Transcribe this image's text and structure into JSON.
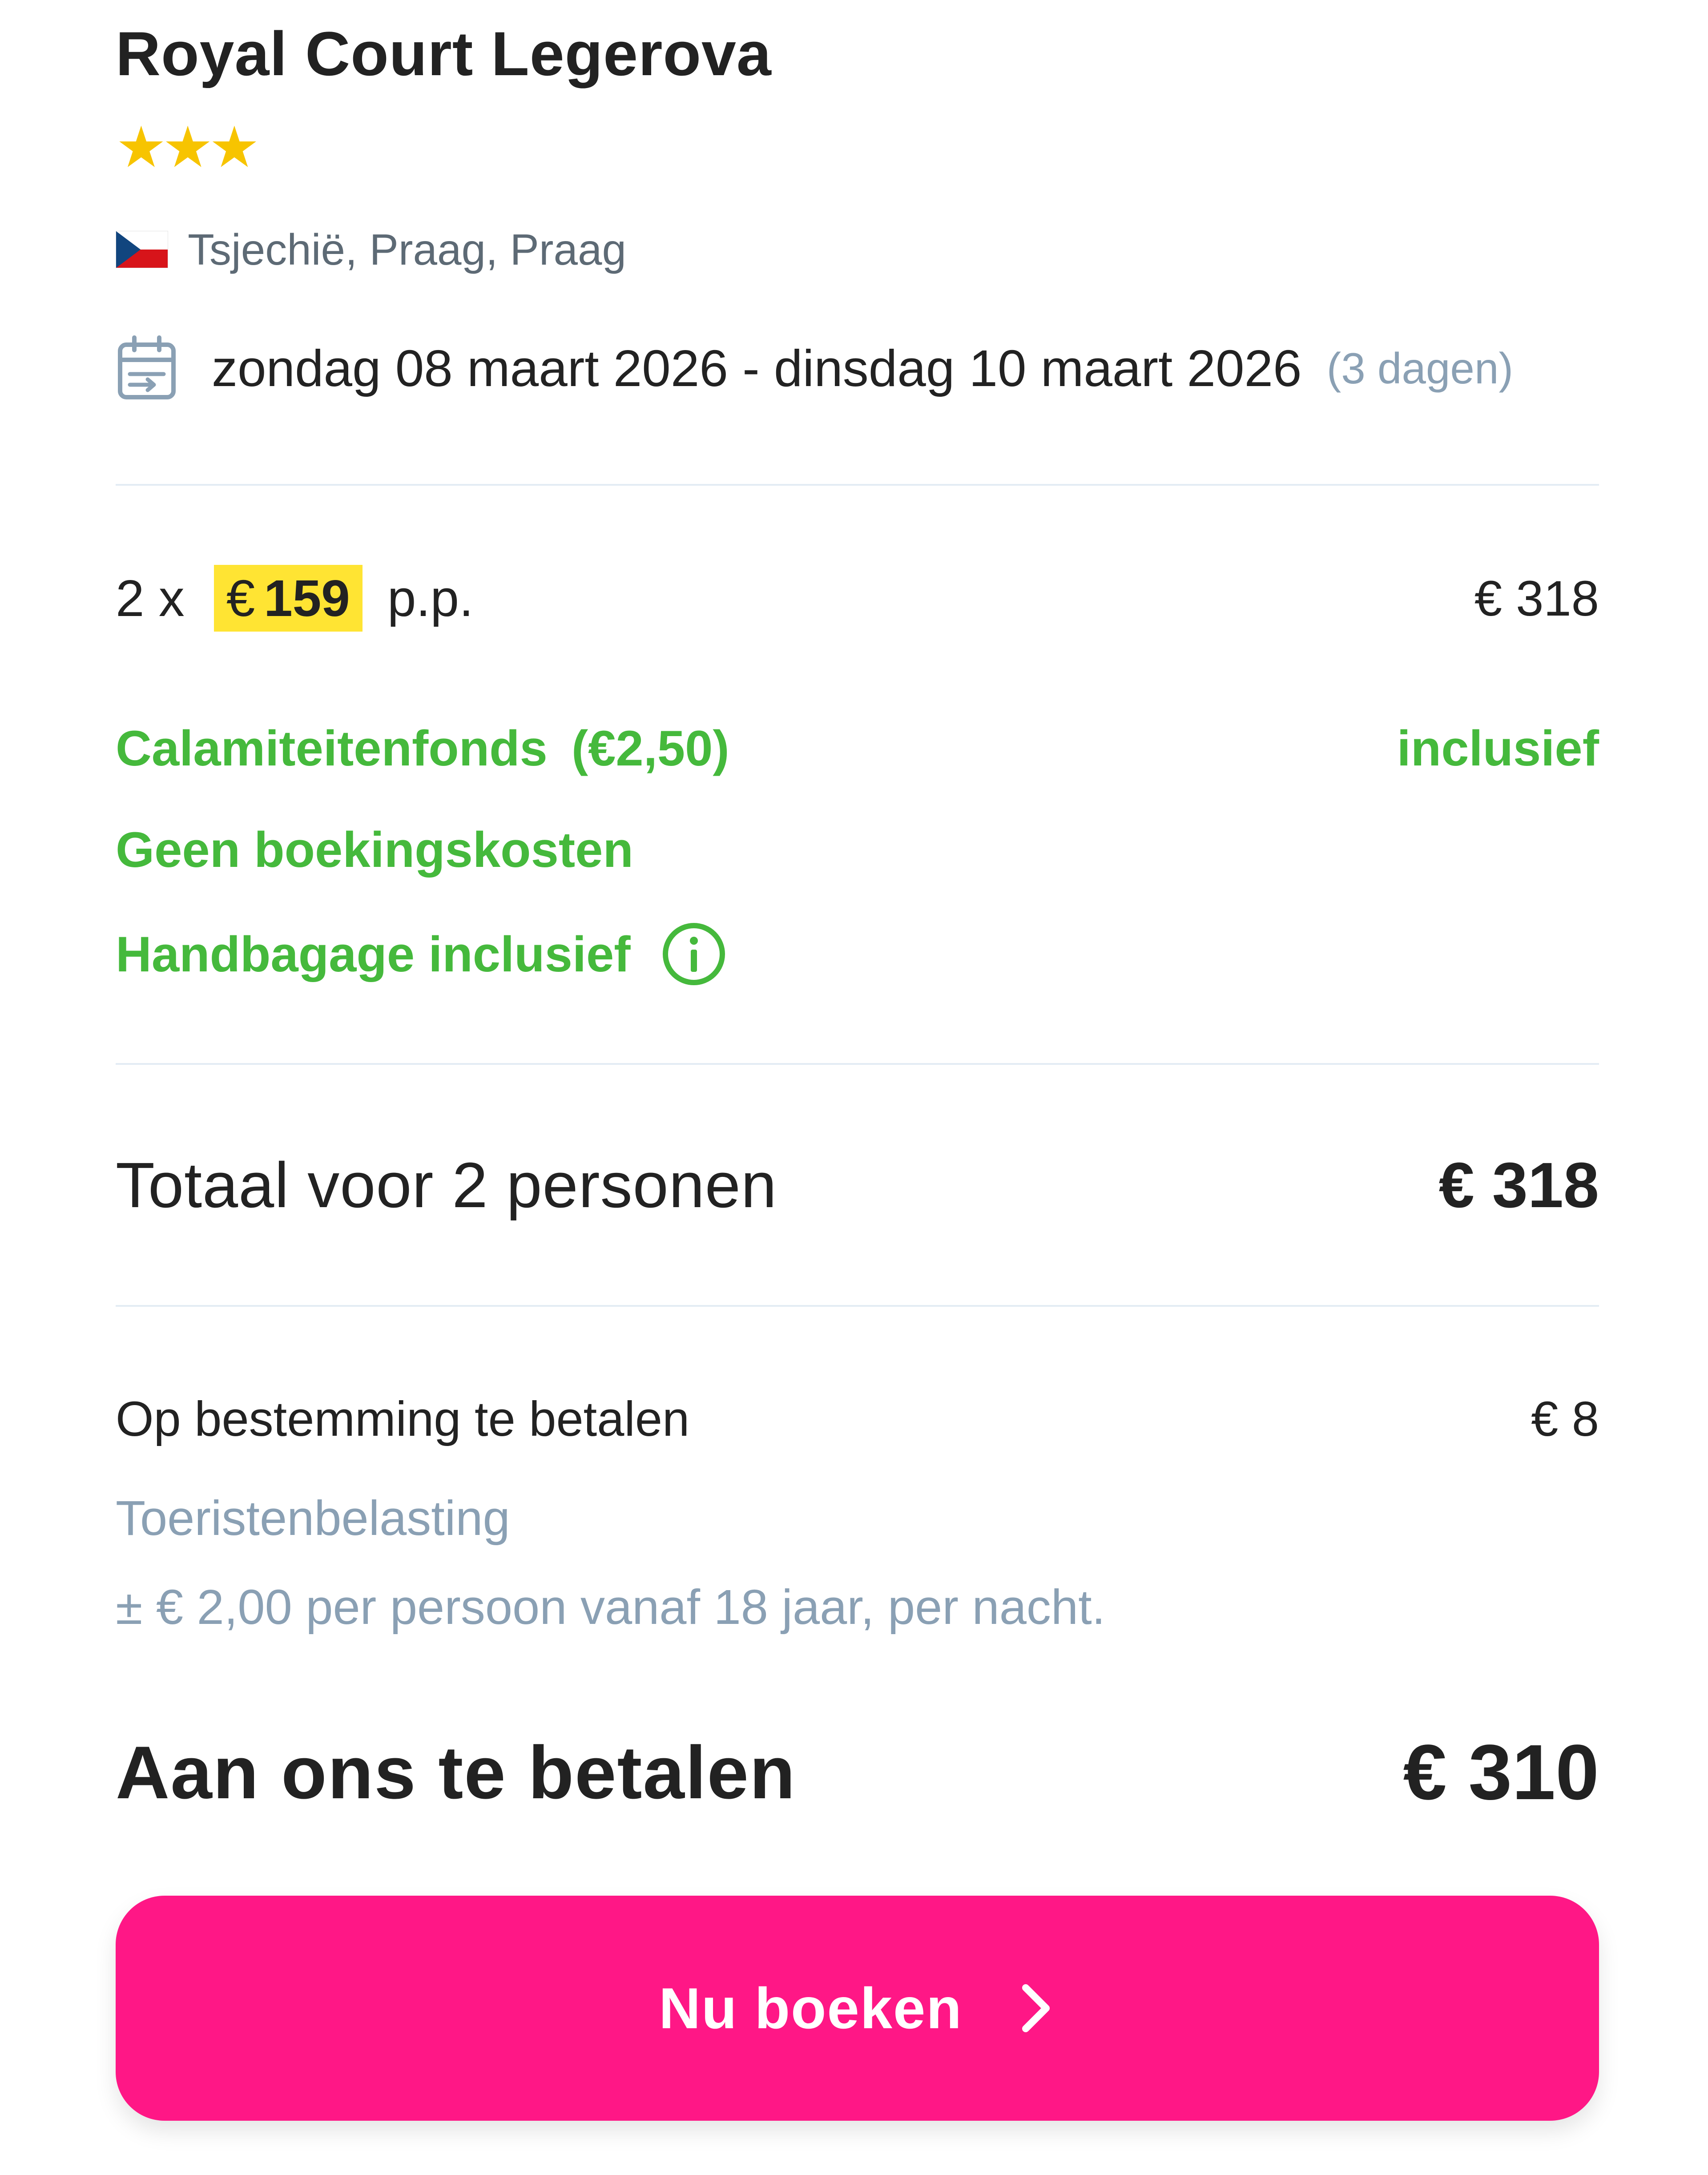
{
  "hotel": {
    "name": "Royal Court Legerova",
    "stars": 3,
    "stars_display": "★★★",
    "flag_icon": "czech-flag-icon",
    "location": "Tsjechië, Praag, Praag"
  },
  "trip": {
    "calendar_icon": "calendar-icon",
    "dates": "zondag 08 maart 2026 - dinsdag 10 maart 2026",
    "duration": "(3 dagen)"
  },
  "pricing": {
    "quantity": "2 x",
    "price_currency": "€",
    "price_per_person": "159",
    "per_person_suffix": "p.p.",
    "subtotal": "€ 318",
    "fund_label": "Calamiteitenfonds",
    "fund_amount": "(€2,50)",
    "fund_status": "inclusief",
    "no_booking_fee": "Geen boekingskosten",
    "hand_luggage": "Handbagage inclusief",
    "info_icon": "info-icon"
  },
  "total": {
    "label": "Totaal voor 2 personen",
    "value": "€ 318"
  },
  "destination_payment": {
    "label": "Op bestemming te betalen",
    "value": "€ 8",
    "tax_label": "Toeristenbelasting",
    "tax_detail": "± € 2,00 per persoon vanaf 18 jaar, per nacht."
  },
  "due": {
    "label": "Aan ons te betalen",
    "value": "€ 310"
  },
  "cta": {
    "label": "Nu boeken",
    "icon": "chevron-right-icon"
  },
  "colors": {
    "accent_pink": "#ff1786",
    "success_green": "#45b93c",
    "highlight_yellow": "#ffe433",
    "star_gold": "#f7c400",
    "muted_blue_gray": "#8aa0b4"
  }
}
